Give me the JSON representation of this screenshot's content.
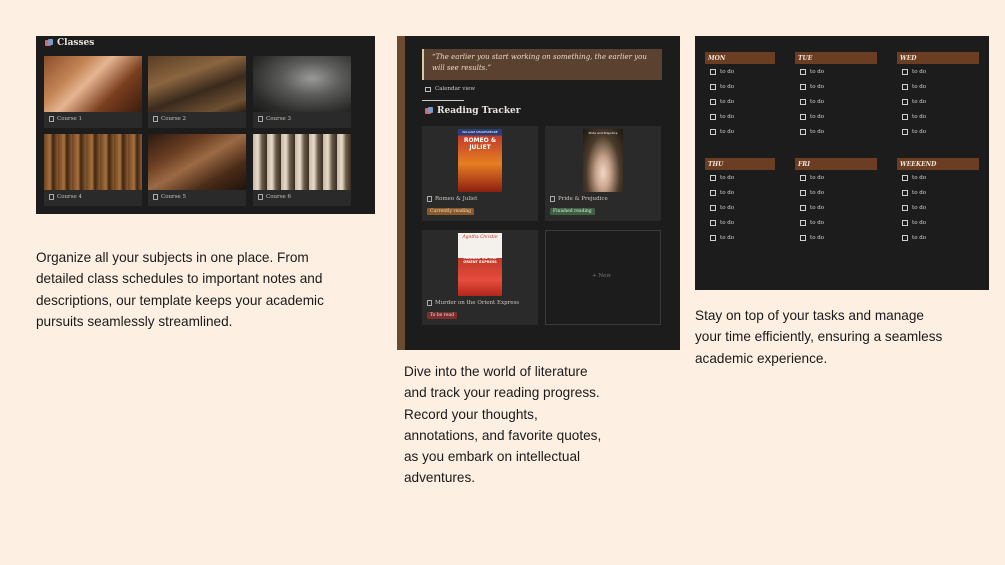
{
  "classes": {
    "title": "Classes",
    "courses": [
      "Course 1",
      "Course 2",
      "Course 3",
      "Course 4",
      "Course 5",
      "Course 6"
    ]
  },
  "reading": {
    "quote_line1": "“The earlier you start working on something, the earlier you",
    "quote_line2": "will see results.”",
    "view_label": "Calendar view",
    "title": "Reading Tracker",
    "books": [
      {
        "title": "Romeo & Juliet",
        "status": "Currently reading",
        "status_color": "#8a5a2b",
        "cover_top": "WILLIAM SHAKESPEARE",
        "cover_main": "ROMEO & JULIET"
      },
      {
        "title": "Pride & Prejudice",
        "status": "Finished reading",
        "status_color": "#3f5f45",
        "cover_top": "Pride and Prejudice",
        "cover_main": ""
      },
      {
        "title": "Murder on the Orient Express",
        "status": "To be read",
        "status_color": "#7a2f2f",
        "cover_top": "Agatha Christie",
        "cover_main": "MURDER ON THE ORIENT EXPRESS"
      }
    ],
    "new_label": "+ New"
  },
  "tasks": {
    "days": [
      "MON",
      "TUE",
      "WED",
      "THU",
      "FRI",
      "WEEKEND"
    ],
    "item": "to do"
  },
  "descriptions": {
    "classes": [
      "Organize all your subjects in one place. From",
      "detailed class schedules to important notes and",
      "descriptions, our template keeps your academic",
      "pursuits seamlessly streamlined."
    ],
    "reading": [
      "Dive into the world of literature",
      "and track your reading progress.",
      "Record your thoughts,",
      "annotations, and favorite quotes,",
      "as you embark on intellectual",
      "adventures."
    ],
    "tasks": [
      "Stay on top of your tasks and manage",
      "your time efficiently, ensuring a seamless",
      "academic experience."
    ]
  }
}
